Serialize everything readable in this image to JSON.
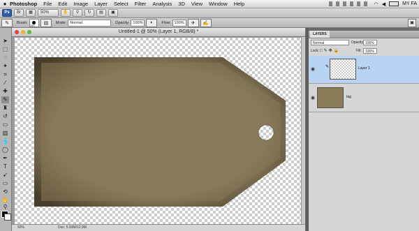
{
  "menu": {
    "apple": "",
    "app_name": "Photoshop",
    "items": [
      "File",
      "Edit",
      "Image",
      "Layer",
      "Select",
      "Filter",
      "Analysis",
      "3D",
      "View",
      "Window",
      "Help"
    ],
    "status_user": "MY FA"
  },
  "app_bar": {
    "ps_logo": "Ps",
    "zoom": "50%"
  },
  "options_bar": {
    "brush_label": "Brush:",
    "brush_size": "150",
    "mode_label": "Mode:",
    "mode_value": "Normal",
    "opacity_label": "Opacity:",
    "opacity_value": "100%",
    "flow_label": "Flow:",
    "flow_value": "100%"
  },
  "document": {
    "title": "Untitled-1 @ 50% (Layer 1, RGB/8) *",
    "zoom": "50%",
    "doc_size": "Doc: 5.93M/12.9M"
  },
  "layers_panel": {
    "tab": "LAYERS",
    "blend_mode": "Normal",
    "opacity_label": "Opacity:",
    "opacity_value": "100%",
    "lock_label": "Lock:",
    "fill_label": "Fill:",
    "fill_value": "100%",
    "layers": [
      {
        "name": "Layer 1",
        "selected": true
      },
      {
        "name": "tag",
        "selected": false
      }
    ]
  },
  "colors": {
    "tag_fill": "#8a7b59",
    "selection_highlight": "#b9d3f3",
    "brand_blue": "#2d5fa8"
  }
}
